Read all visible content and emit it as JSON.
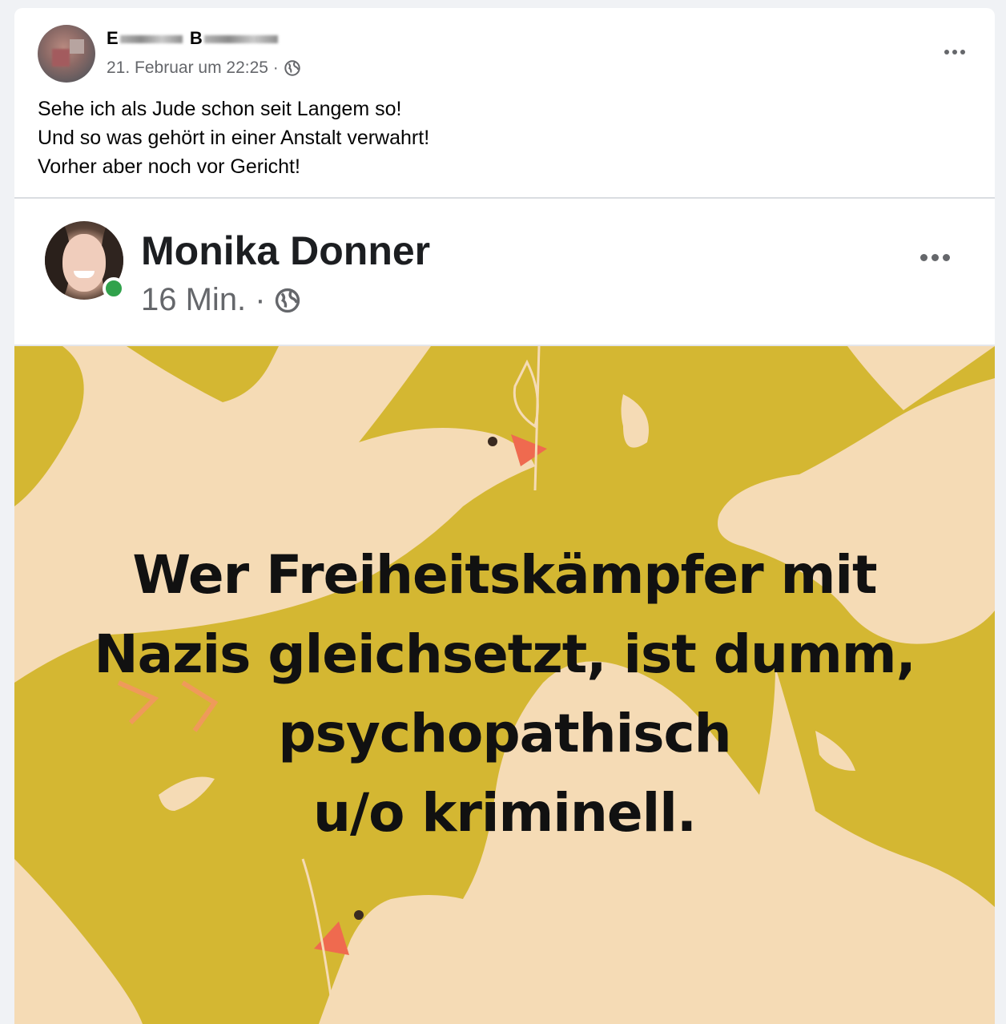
{
  "post": {
    "author_first": "E",
    "author_last": "B",
    "date": "21. Februar um 22:25 ·",
    "privacy_icon": "globe-icon",
    "text_lines": [
      "Sehe ich als Jude schon seit Langem so!",
      "Und so was gehört in einer Anstalt verwahrt!",
      "Vorher aber noch vor Gericht!"
    ]
  },
  "shared_post": {
    "author": "Monika Donner",
    "time": "16 Min. ·",
    "online_status_color": "#31a24c",
    "image": {
      "background_color": "#d4b732",
      "quote_lines": [
        "Wer Freiheitskämpfer mit",
        "Nazis gleichsetzt, ist dumm,",
        "psychopathisch",
        "u/o kriminell."
      ]
    }
  },
  "colors": {
    "card": "#ffffff",
    "page": "#f0f2f5",
    "secondary_text": "#65676b"
  }
}
